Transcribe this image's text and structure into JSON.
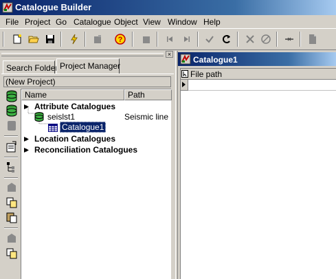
{
  "app": {
    "title": "Catalogue Builder"
  },
  "menu": [
    "File",
    "Project",
    "Go",
    "Catalogue",
    "Object",
    "View",
    "Window",
    "Help"
  ],
  "toolbar": {
    "buttons": [
      "new-icon",
      "open-folder-icon",
      "save-icon",
      "lightning-icon",
      "new-object-icon",
      "help-icon",
      "delete-icon",
      "first-icon",
      "last-icon",
      "check-icon",
      "refresh-icon",
      "cross-icon",
      "cancel-icon",
      "link-icon",
      "document-icon"
    ]
  },
  "left_pane": {
    "tabs": [
      "Search Folder",
      "Project Manager"
    ],
    "active_tab": "Project Manager",
    "project_combo": "(New Project)",
    "columns": [
      "Name",
      "Path"
    ],
    "tree": [
      {
        "label": "Attribute Catalogues"
      },
      {
        "label": "seislst1",
        "path": "Seismic line lis"
      },
      {
        "label": "Catalogue1"
      },
      {
        "label": "Location Catalogues"
      },
      {
        "label": "Reconciliation Catalogues"
      }
    ]
  },
  "right_pane": {
    "window_title": "Catalogue1",
    "grid_header": "File path"
  }
}
